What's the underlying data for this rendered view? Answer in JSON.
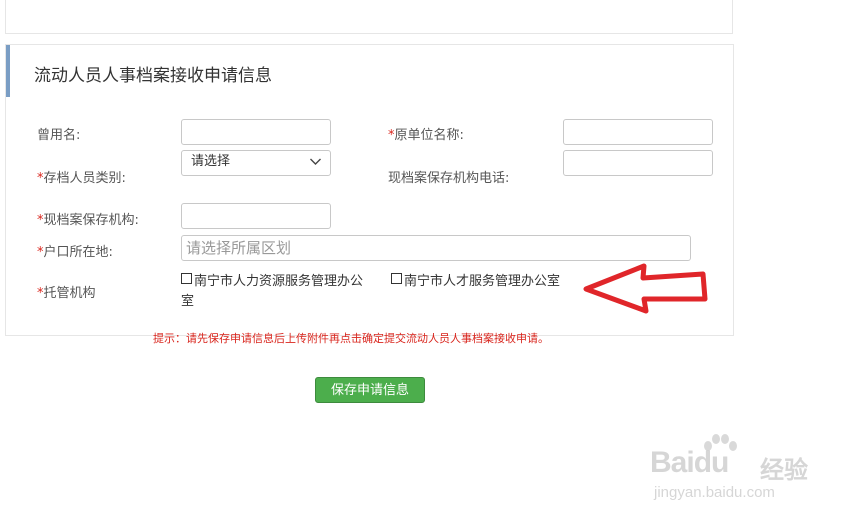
{
  "panel_title": "流动人员人事档案接收申请信息",
  "required_mark": "*",
  "fields": {
    "former_name": {
      "label": "曾用名:"
    },
    "original_unit": {
      "label": "原单位名称:"
    },
    "person_category": {
      "label": "存档人员类别:",
      "value": "请选择"
    },
    "current_institution_phone": {
      "label": "现档案保存机构电话:"
    },
    "current_institution": {
      "label": "现档案保存机构:"
    },
    "household_location": {
      "label": "户口所在地:",
      "placeholder": "请选择所属区划"
    },
    "custody_org": {
      "label": "托管机构",
      "options": [
        {
          "text_line1": "南宁市人力资源服务管理办公",
          "text_line2": "室",
          "checked": false
        },
        {
          "text": "南宁市人才服务管理办公室",
          "checked": false
        }
      ]
    }
  },
  "hint": "提示：请先保存申请信息后上传附件再点击确定提交流动人员人事档案接收申请。",
  "save_button": "保存申请信息",
  "watermark": {
    "brand": "Bai",
    "brand2": "du",
    "cn": "经验",
    "url": "jingyan.baidu.com"
  },
  "colors": {
    "accent_border": "#7a9dc4",
    "required": "#d9251d",
    "button": "#4cae4c",
    "arrow": "#e0262a"
  }
}
